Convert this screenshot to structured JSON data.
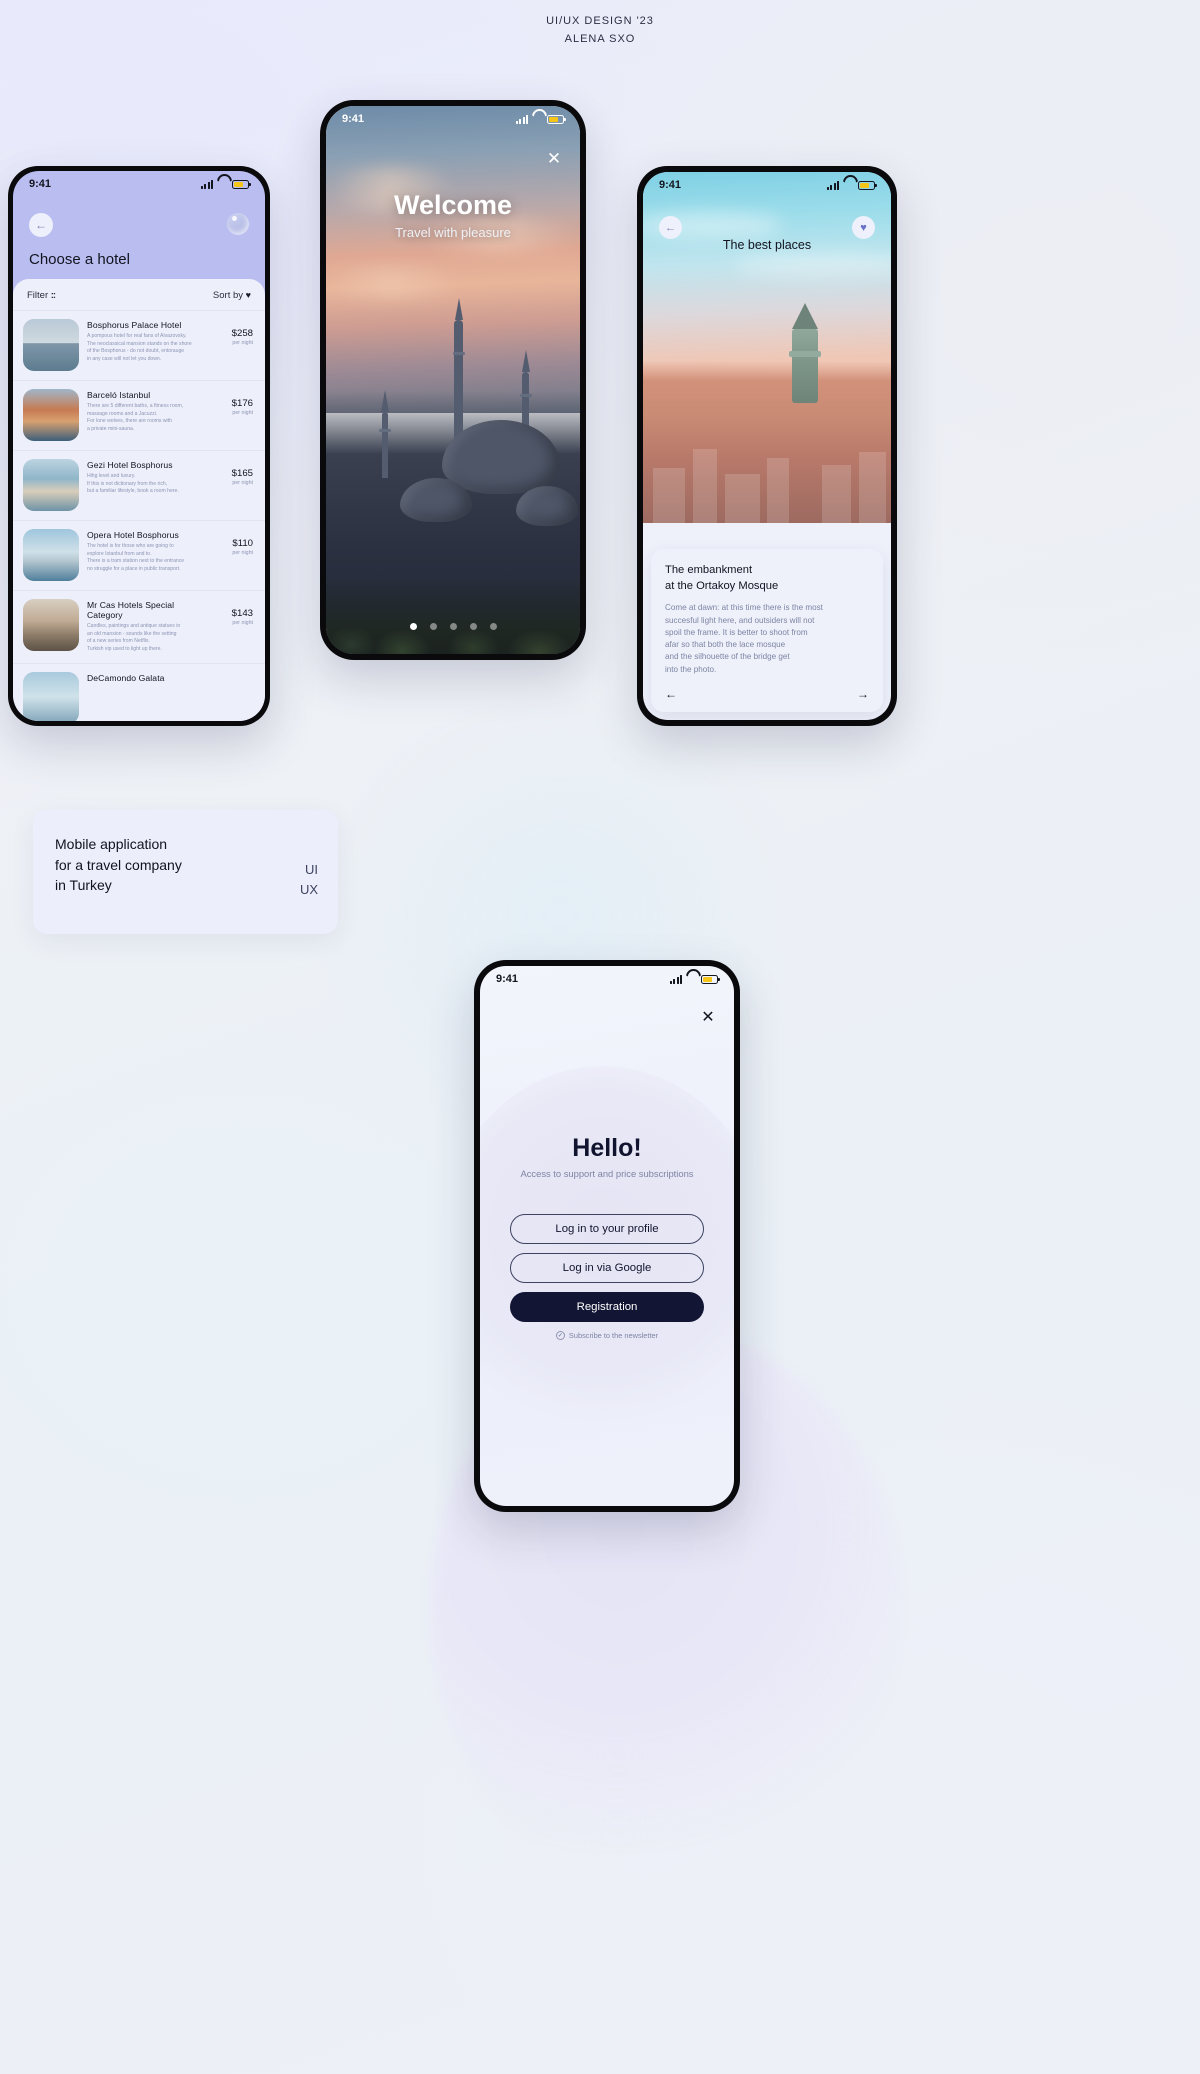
{
  "board": {
    "header_line1": "UI/UX DESIGN '23",
    "header_line2": "ALENA SXO"
  },
  "about_card": {
    "text": "Mobile application\nfor a travel company\nin Turkey",
    "tag_ui": "UI",
    "tag_ux": "UX"
  },
  "hotels_screen": {
    "status_time": "9:41",
    "back_icon": "←",
    "title": "Choose a hotel",
    "filter_label": "Filter",
    "filter_icon": "::",
    "sort_label": "Sort by",
    "sort_icon": "♥",
    "items": [
      {
        "name": "Bosphorus Palace Hotel",
        "desc": "A pompous hotel for real fans of Aivazovsky.\nThe neoclassical mansion stands on the shore\nof the Bosphorus - do not doubt, entorauge\nin any case will not let you down.",
        "price": "$258",
        "per": "per night"
      },
      {
        "name": "Barceló Istanbul",
        "desc": "There are 5 different baths, a fitness room,\nmassage rooms and a Jacuzzi.\nFor lone wolves, there are rooms with\na private mini-sauna.",
        "price": "$176",
        "per": "per night"
      },
      {
        "name": "Gezi Hotel Bosphorus",
        "desc": "Hihg level and luxury.\nIf this is not dictionary from the rich,\nbut a familiar lifestyle, book a room here.",
        "price": "$165",
        "per": "per night"
      },
      {
        "name": "Opera Hotel Bosphorus",
        "desc": "The hotel is for those  who are going to\nexplore Istanbul from and to.\nThere is a tram station next to the entrance\nno struggle for a place in public transport.",
        "price": "$110",
        "per": "per night"
      },
      {
        "name": "Mr Cas Hotels Special Category",
        "desc": "Candles, paintings and antique statues in\nan old mansion  - sounds like the setting\nof a new series from Netflix.\nTurkish vip used to light up there.",
        "price": "$143",
        "per": "per night"
      },
      {
        "name": "DeCamondo Galata",
        "desc": "",
        "price": "",
        "per": ""
      }
    ]
  },
  "welcome_screen": {
    "status_time": "9:41",
    "close_icon": "✕",
    "title": "Welcome",
    "subtitle": "Travel with pleasure",
    "carousel_dots": 5,
    "carousel_active_index": 0
  },
  "places_screen": {
    "status_time": "9:41",
    "back_icon": "←",
    "favorite_icon": "♥",
    "title": "The best places",
    "card_title": "The embankment\nat the Ortakoy Mosque",
    "card_body": "Come at dawn: at this time there is the most\nsuccesful light here, and outsiders will not\nspoil the frame. It is better to shoot from\nafar so that both the lace mosque\nand the silhouette of the bridge get\ninto the photo.",
    "prev_icon": "←",
    "next_icon": "→"
  },
  "login_screen": {
    "status_time": "9:41",
    "close_icon": "✕",
    "title": "Hello!",
    "subtitle": "Access to support and price subscriptions",
    "btn_profile": "Log in to your profile",
    "btn_google": "Log in via Google",
    "btn_registration": "Registration",
    "newsletter_label": "Subscribe to the newsletter",
    "newsletter_check": "✓"
  },
  "colors": {
    "accent_dark": "#121634",
    "lavender": "#b9bdf0",
    "sheet": "#edf0fa",
    "muted_text": "#8d94b5"
  }
}
